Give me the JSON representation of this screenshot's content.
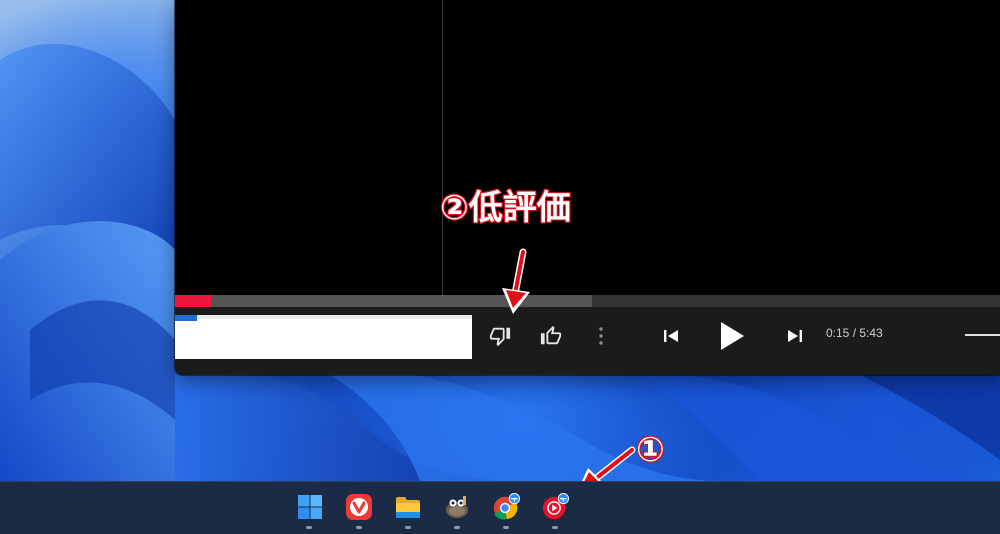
{
  "desktop": {
    "wallpaper": "windows-11-bloom"
  },
  "player": {
    "progress_played": 0.0437,
    "progress_buffered": 0.506,
    "time_display": "0:15 / 5:43",
    "controls": {
      "dislike": "dislike-icon",
      "like": "like-icon",
      "more": "more-vert-icon",
      "previous": "skip-previous-icon",
      "play": "play-icon",
      "next": "skip-next-icon"
    },
    "accent_color": "#f0153b"
  },
  "annotations": {
    "dislike_label": "②低評価",
    "taskbar_marker": "①"
  },
  "taskbar": {
    "items": [
      {
        "name": "start-button",
        "icon": "windows-logo-icon"
      },
      {
        "name": "vivaldi",
        "icon": "vivaldi-icon"
      },
      {
        "name": "file-explorer",
        "icon": "folder-icon"
      },
      {
        "name": "gimp",
        "icon": "gimp-icon"
      },
      {
        "name": "chrome",
        "icon": "chrome-icon"
      },
      {
        "name": "youtube-music",
        "icon": "youtube-music-icon"
      }
    ]
  }
}
